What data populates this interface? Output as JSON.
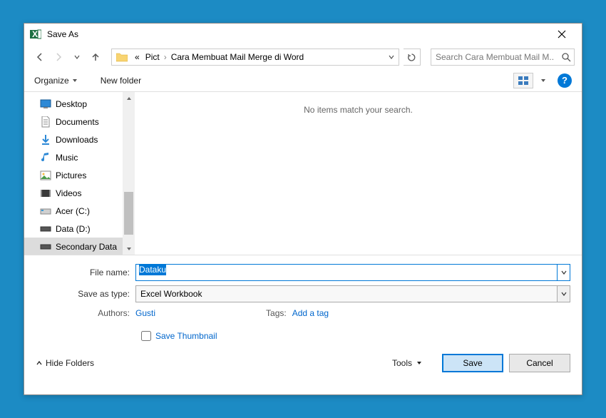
{
  "title": "Save As",
  "breadcrumb": {
    "prefix": "«",
    "item1": "Pict",
    "item2": "Cara Membuat Mail Merge di Word"
  },
  "search_placeholder": "Search Cara Membuat Mail M...",
  "toolbar": {
    "organize": "Organize",
    "newfolder": "New folder"
  },
  "tree": {
    "items": [
      {
        "label": "Desktop"
      },
      {
        "label": "Documents"
      },
      {
        "label": "Downloads"
      },
      {
        "label": "Music"
      },
      {
        "label": "Pictures"
      },
      {
        "label": "Videos"
      },
      {
        "label": "Acer (C:)"
      },
      {
        "label": "Data  (D:)"
      },
      {
        "label": "Secondary Data"
      }
    ]
  },
  "content_empty": "No items match your search.",
  "form": {
    "filename_label": "File name:",
    "filename_value": "Dataku",
    "savetype_label": "Save as type:",
    "savetype_value": "Excel Workbook",
    "authors_label": "Authors:",
    "authors_value": "Gusti",
    "tags_label": "Tags:",
    "tags_value": "Add a tag",
    "thumb_label": "Save Thumbnail"
  },
  "footer": {
    "hide": "Hide Folders",
    "tools": "Tools",
    "save": "Save",
    "cancel": "Cancel"
  }
}
